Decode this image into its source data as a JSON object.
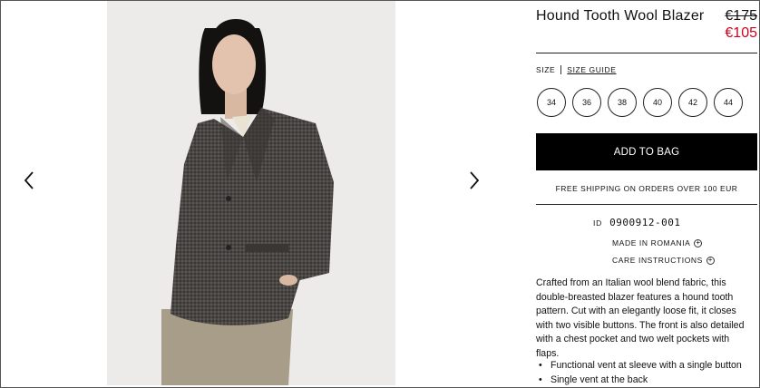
{
  "product": {
    "title": "Hound Tooth Wool Blazer",
    "price_old": "€175",
    "price_new": "€105",
    "price_sale_color": "#d0021b"
  },
  "gallery": {
    "prev_icon": "chevron-left-icon",
    "next_icon": "chevron-right-icon"
  },
  "size": {
    "label": "SIZE",
    "guide_label": "SIZE GUIDE",
    "options": [
      "34",
      "36",
      "38",
      "40",
      "42",
      "44"
    ]
  },
  "actions": {
    "add_to_bag": "ADD TO BAG"
  },
  "shipping": "FREE SHIPPING ON ORDERS OVER 100 EUR",
  "details": {
    "id_label": "ID",
    "id_value": "0900912-001",
    "made_in": "MADE IN ROMANIA",
    "care": "CARE INSTRUCTIONS",
    "expand_icon": "plus-circle-icon"
  },
  "description": {
    "lines": [
      "Crafted from an Italian wool blend fabric, this",
      "double-breasted blazer features a hound tooth",
      "pattern. Cut with an elegantly loose fit, it closes",
      "with two visible buttons.  The front is also detailed",
      "with a chest pocket and two welt pockets with",
      "flaps."
    ],
    "bullets": [
      "Functional vent at sleeve with a single button",
      "Single vent at the back"
    ]
  }
}
